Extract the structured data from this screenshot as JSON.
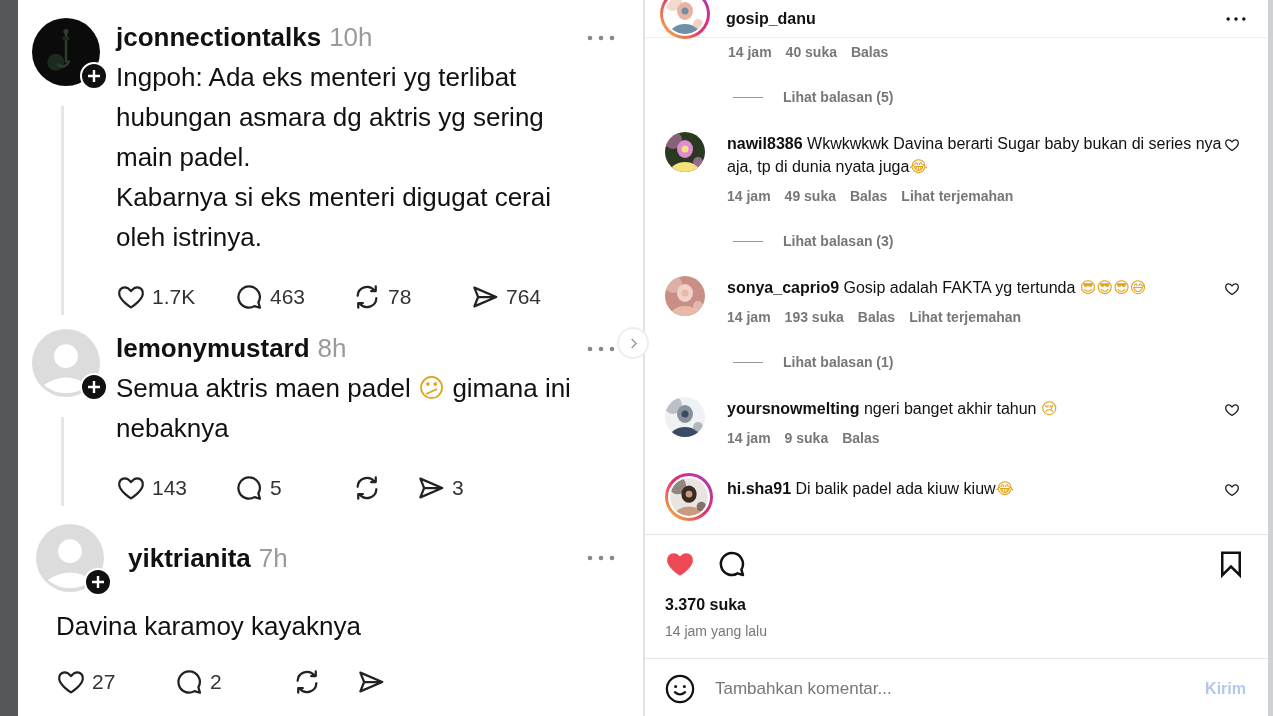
{
  "threads": [
    {
      "kind": "indented",
      "avatar": {
        "kind": "picture"
      },
      "follow_badge": true,
      "username": "jconnectiontalks",
      "time": "10h",
      "thread_line": true,
      "scroll_arrow": false,
      "paragraphs": [
        "Ingpoh: Ada eks menteri yg terlibat hubungan asmara dg aktris yg sering main padel.",
        "Kabarnya si eks menteri digugat cerai oleh istrinya."
      ],
      "stats": [
        {
          "kind": "like",
          "count": "1.7K"
        },
        {
          "kind": "reply",
          "count": "463"
        },
        {
          "kind": "repost",
          "count": "78"
        },
        {
          "kind": "share",
          "count": "764"
        }
      ]
    },
    {
      "kind": "indented",
      "avatar": {
        "kind": "default"
      },
      "follow_badge": true,
      "username": "lemonymustard",
      "time": "8h",
      "thread_line": true,
      "scroll_arrow": true,
      "paragraphs": [
        "Semua aktris maen padel 😕 gimana ini nebaknya"
      ],
      "stats": [
        {
          "kind": "like",
          "count": "143"
        },
        {
          "kind": "reply",
          "count": "5"
        },
        {
          "kind": "repost"
        },
        {
          "kind": "share",
          "count": "3"
        }
      ]
    },
    {
      "kind": "full",
      "avatar": {
        "kind": "default"
      },
      "follow_badge": true,
      "username": "yiktrianita",
      "time": "7h",
      "thread_line": false,
      "scroll_arrow": false,
      "paragraphs": [
        "Davina karamoy kayaknya"
      ],
      "stats": [
        {
          "kind": "like",
          "count": "27"
        },
        {
          "kind": "reply",
          "count": "2"
        },
        {
          "kind": "repost"
        },
        {
          "kind": "share"
        }
      ]
    }
  ],
  "post": {
    "username": "gosip_danu",
    "comments": [
      {
        "kind": "meta",
        "time": "14 jam",
        "likes": "40 suka",
        "reply": "Balas"
      },
      {
        "kind": "replies",
        "text": "Lihat balasan (5)"
      },
      {
        "kind": "comment",
        "story_ring": false,
        "username": "nawil8386",
        "text": "Wkwkwkwk Davina berarti Sugar baby bukan di series nya aja, tp di dunia nyata juga😂",
        "liked": false,
        "time": "14 jam",
        "likes": "49 suka",
        "reply": "Balas",
        "translate": "Lihat terjemahan"
      },
      {
        "kind": "replies",
        "text": "Lihat balasan (3)"
      },
      {
        "kind": "comment",
        "story_ring": false,
        "username": "sonya_caprio9",
        "text": "Gosip adalah FAKTA yg tertunda 😎😎😎😅",
        "liked": false,
        "time": "14 jam",
        "likes": "193 suka",
        "reply": "Balas",
        "translate": "Lihat terjemahan"
      },
      {
        "kind": "replies",
        "text": "Lihat balasan (1)"
      },
      {
        "kind": "comment",
        "story_ring": false,
        "username": "yoursnowmelting",
        "text": "ngeri banget akhir tahun 😢",
        "liked": false,
        "time": "14 jam",
        "likes": "9 suka",
        "reply": "Balas"
      },
      {
        "kind": "comment",
        "story_ring": true,
        "username": "hi.sha91",
        "text": "Di balik padel ada kiuw kiuw😂",
        "liked": false
      }
    ],
    "liked": true,
    "saved": false,
    "likes": "3.370 suka",
    "time_ago": "14 jam yang lalu",
    "comment_field": {
      "placeholder": "Tambahkan komentar..."
    },
    "send": {
      "label": "Kirim",
      "disabled": true
    }
  }
}
